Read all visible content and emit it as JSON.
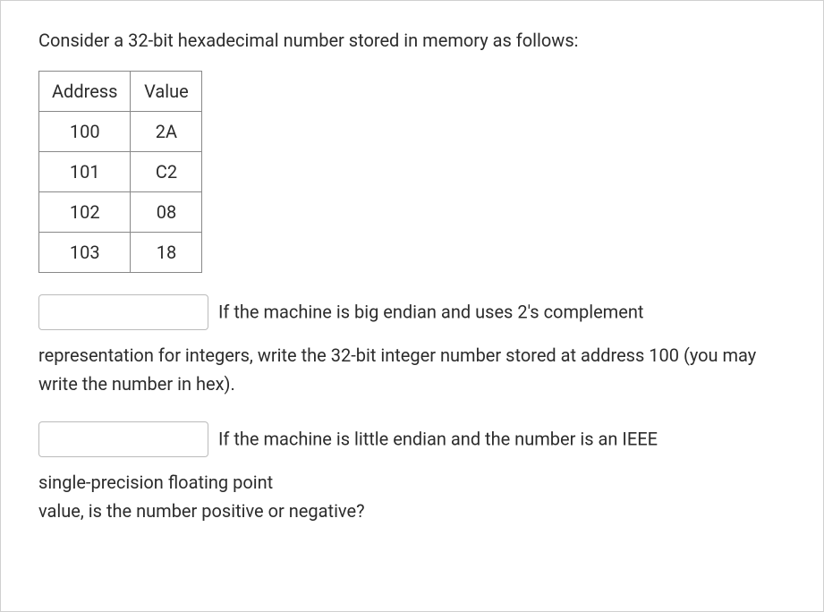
{
  "intro": "Consider a 32-bit hexadecimal number stored in memory as follows:",
  "table": {
    "headers": [
      "Address",
      "Value"
    ],
    "rows": [
      {
        "address": "100",
        "value": "2A"
      },
      {
        "address": "101",
        "value": "C2"
      },
      {
        "address": "102",
        "value": "08"
      },
      {
        "address": "103",
        "value": "18"
      }
    ]
  },
  "q1": {
    "inline": "If the machine is big endian and uses 2's complement",
    "rest": "representation for integers, write the 32-bit integer number stored at address 100 (you may write the number in hex)."
  },
  "q2": {
    "inline": "If the machine is little endian and the number is an IEEE",
    "rest1": "single-precision floating point",
    "rest2": "value, is the number positive or negative?"
  }
}
